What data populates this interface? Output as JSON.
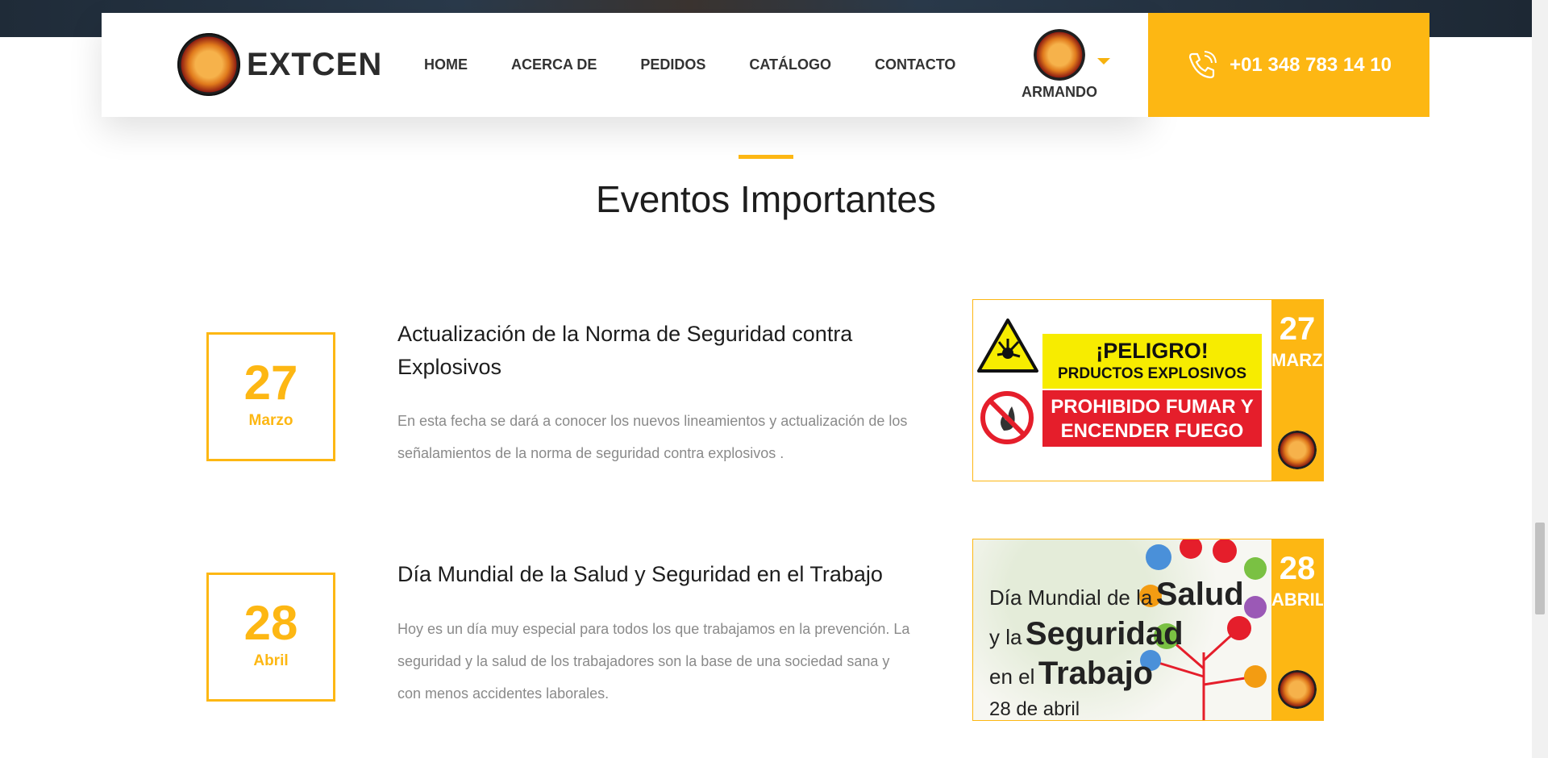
{
  "header": {
    "brand_name": "EXTCEN",
    "nav": [
      "HOME",
      "ACERCA DE",
      "PEDIDOS",
      "CATÁLOGO",
      "CONTACTO"
    ],
    "user_name": "ARMANDO",
    "phone": "+01 348 783 14 10"
  },
  "section": {
    "title": "Eventos Importantes"
  },
  "events": [
    {
      "day": "27",
      "month": "Marzo",
      "title": "Actualización de la Norma de Seguridad contra Explosivos",
      "text": "En esta fecha se dará a conocer los nuevos lineamientos y actualización de los señalamientos de la norma de seguridad contra explosivos .",
      "poster": {
        "band_day": "27",
        "band_month": "MARZO",
        "warning_line1": "¡PELIGRO!",
        "warning_line2": "PRDUCTOS EXPLOSIVOS",
        "prohibition_text": "PROHIBIDO FUMAR Y ENCENDER FUEGO"
      }
    },
    {
      "day": "28",
      "month": "Abril",
      "title": "Día Mundial de la Salud y Seguridad en el Trabajo",
      "text": "Hoy es un día muy especial para todos los que trabajamos en la prevención. La seguridad y la salud de los trabajadores son la base de una sociedad sana y con menos accidentes laborales.",
      "poster": {
        "band_day": "28",
        "band_month": "ABRIL",
        "line1_small": "Día Mundial de la",
        "line1_big": "Salud",
        "line2_small": "y la",
        "line2_big": "Seguridad",
        "line3_small": "en el",
        "line3_big": "Trabajo",
        "date": "28 de abril"
      }
    }
  ],
  "colors": {
    "accent": "#fdb713",
    "danger_red": "#e51e2b",
    "warning_yellow": "#f7ec00"
  }
}
